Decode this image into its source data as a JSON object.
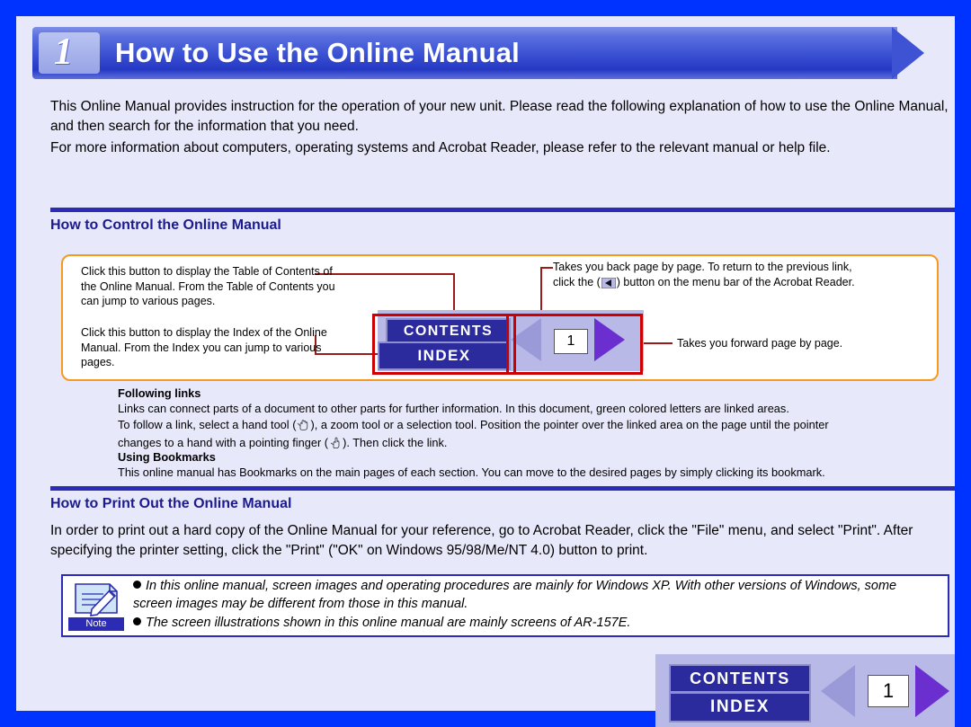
{
  "header": {
    "number": "1",
    "title": "How to Use the Online Manual"
  },
  "intro": {
    "para1": "This Online Manual provides instruction for the operation of your new unit. Please read the following explanation of how to use the Online Manual, and then search for the information that you need.",
    "para2": "For more information about computers, operating systems and Acrobat Reader, please refer to the relevant manual or help file."
  },
  "section_control": {
    "title": "How to Control the Online Manual",
    "callout_contents": "Click this button to display the Table of Contents of the Online Manual. From the Table of Contents you can jump to various pages.",
    "callout_index": "Click this button to display the Index of the Online Manual. From the Index you can jump to various pages.",
    "callout_back_a": "Takes you back page by page. To return to the previous link,",
    "callout_back_b": "click the (",
    "callout_back_c": ") button on the menu bar of the Acrobat Reader.",
    "callout_forward": "Takes you forward page by page.",
    "widget": {
      "contents_label": "CONTENTS",
      "index_label": "INDEX",
      "page_number": "1"
    }
  },
  "following_links": {
    "title": "Following links",
    "line1": "Links can connect parts of a document to other parts for further information. In this document, green colored letters are linked areas.",
    "line2a": "To follow a link, select a hand tool (",
    "line2b": "), a zoom tool or a selection tool. Position the pointer over the linked area on the page until the pointer",
    "line3a": "changes to a hand with a pointing finger (",
    "line3b": "). Then click the link."
  },
  "using_bookmarks": {
    "title": "Using Bookmarks",
    "line1": "This online manual has Bookmarks on the main pages of each section. You can move to the desired pages by simply clicking its bookmark."
  },
  "section_print": {
    "title": "How to Print Out the Online Manual",
    "para": "In order to print out a hard copy of the Online Manual for your reference, go to Acrobat Reader, click the \"File\" menu, and select \"Print\". After specifying the printer setting, click the \"Print\" (\"OK\" on Windows 95/98/Me/NT 4.0) button to print."
  },
  "note": {
    "label": "Note",
    "line1": "In this online manual, screen images and operating procedures are mainly for Windows XP. With other versions of Windows, some screen images may be different from those in this manual.",
    "line2": "The screen illustrations shown in this online manual are mainly screens of AR-157E."
  },
  "footer": {
    "contents_label": "CONTENTS",
    "index_label": "INDEX",
    "page_number": "1"
  },
  "colors": {
    "page_background": "#0033ff",
    "paper": "#e8e8fb",
    "banner": "#3d53d4",
    "heading_blue": "#1b1b8f",
    "rule_blue": "#2b2bb5",
    "orange_border": "#f59a1e",
    "connector_red": "#9b1b1b",
    "highlight_red": "#cc0000",
    "button_blue": "#2b2b9e",
    "widget_lavender": "#b9b9e8",
    "arrow_purple": "#6b2fcf",
    "arrow_grey": "#9a9ad8"
  }
}
